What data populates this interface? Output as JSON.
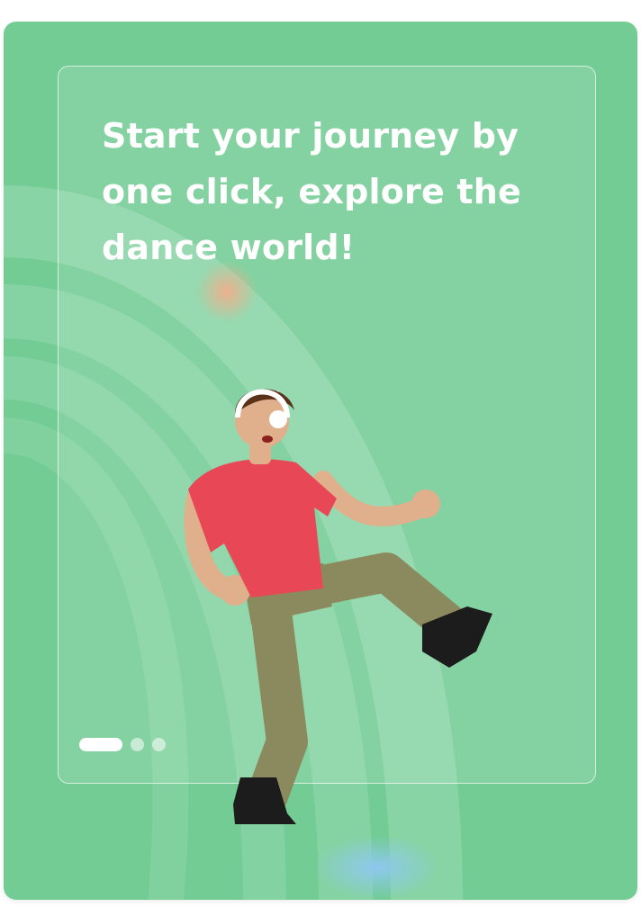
{
  "onboarding": {
    "headline": "Start your journey by one click, explore the dance world!",
    "illustration_icon": "dancer-with-headphones",
    "pagination": {
      "total": 3,
      "current": 1
    }
  },
  "colors": {
    "card_background": "#72cc94",
    "panel_border": "#ffffff",
    "headline_text": "#ffffff",
    "shirt": "#e84855",
    "pants": "#8b8a5e",
    "accent_glow": "#f0a37a",
    "bottom_glow": "#8ec8f0"
  }
}
